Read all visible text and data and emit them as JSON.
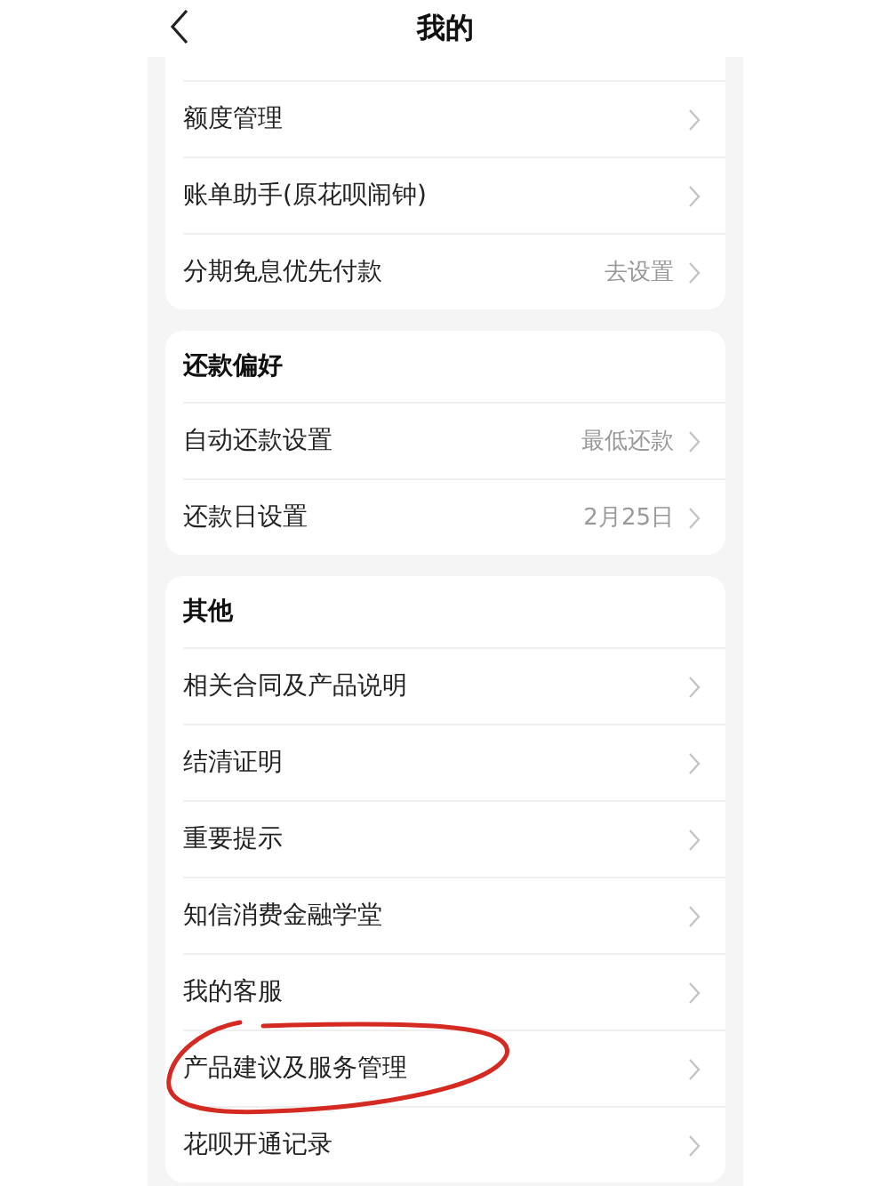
{
  "header": {
    "title": "我的"
  },
  "sections": [
    {
      "items": [
        {
          "label": "额度管理",
          "annotated": false
        },
        {
          "label": "账单助手(原花呗闹钟)",
          "annotated": false
        },
        {
          "label": "分期免息优先付款",
          "value": "去设置",
          "annotated": false
        }
      ]
    },
    {
      "title": "还款偏好",
      "items": [
        {
          "label": "自动还款设置",
          "value": "最低还款",
          "annotated": false
        },
        {
          "label": "还款日设置",
          "value": "2月25日",
          "annotated": false
        }
      ]
    },
    {
      "title": "其他",
      "items": [
        {
          "label": "相关合同及产品说明",
          "annotated": false
        },
        {
          "label": "结清证明",
          "annotated": false
        },
        {
          "label": "重要提示",
          "annotated": false
        },
        {
          "label": "知信消费金融学堂",
          "annotated": false
        },
        {
          "label": "我的客服",
          "annotated": false
        },
        {
          "label": "产品建议及服务管理",
          "annotated": true
        },
        {
          "label": "花呗开通记录",
          "annotated": false
        }
      ]
    }
  ]
}
